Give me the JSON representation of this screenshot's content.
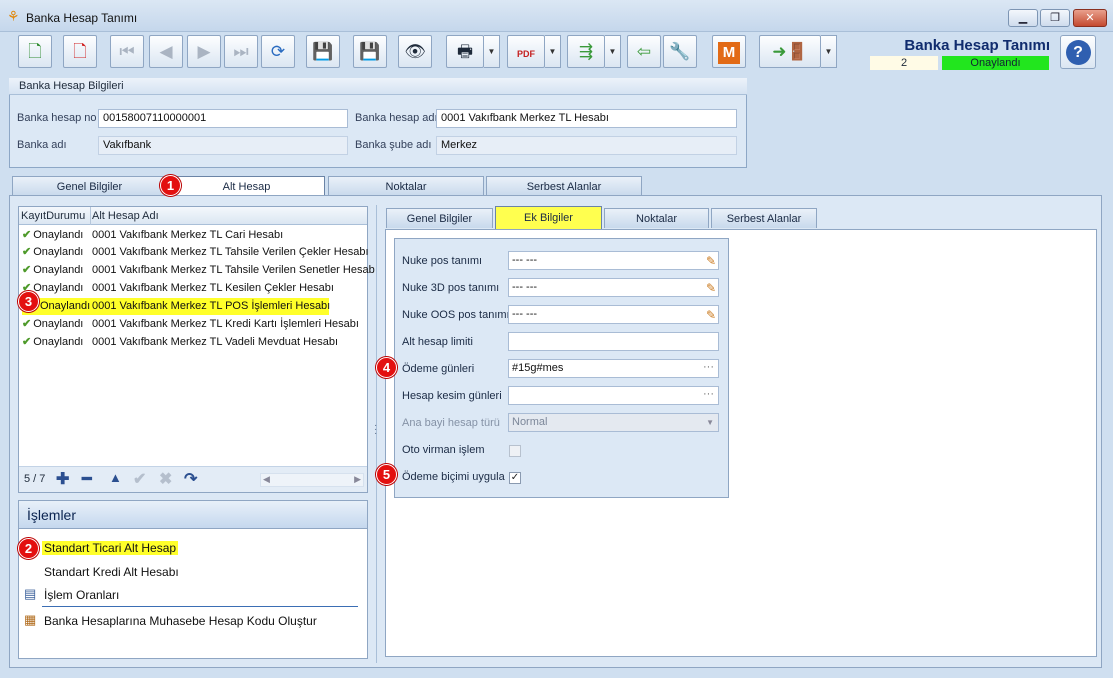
{
  "window": {
    "title": "Banka Hesap Tanımı",
    "minimize": "▁",
    "restore": "❐",
    "close": "✕"
  },
  "header": {
    "title": "Banka Hesap Tanımı",
    "record_no": "2",
    "status": "Onaylandı",
    "help": "?"
  },
  "toolbar": {
    "pdf": "PDF",
    "m_label": "M"
  },
  "group": {
    "title": "Banka Hesap Bilgileri",
    "fields": {
      "hesap_no_label": "Banka hesap no",
      "hesap_no": "00158007110000001",
      "hesap_adi_label": "Banka hesap adı",
      "hesap_adi": "0001 Vakıfbank Merkez TL Hesabı",
      "banka_adi_label": "Banka adı",
      "banka_adi": "Vakıfbank",
      "sube_adi_label": "Banka şube adı",
      "sube_adi": "Merkez"
    }
  },
  "tabs": [
    "Genel Bilgiler",
    "Alt Hesap",
    "Noktalar",
    "Serbest Alanlar"
  ],
  "grid": {
    "columns": [
      "KayıtDurumu",
      "Alt Hesap Adı"
    ],
    "rows": [
      {
        "status": "Onaylandı",
        "name": "0001 Vakıfbank Merkez TL Cari Hesabı"
      },
      {
        "status": "Onaylandı",
        "name": "0001 Vakıfbank Merkez TL Tahsile Verilen Çekler Hesabı"
      },
      {
        "status": "Onaylandı",
        "name": "0001 Vakıfbank Merkez TL Tahsile Verilen Senetler Hesab"
      },
      {
        "status": "Onaylandı",
        "name": "0001 Vakıfbank Merkez TL Kesilen Çekler Hesabı"
      },
      {
        "status": "Onaylandı",
        "name": "0001 Vakıfbank Merkez TL POS İşlemleri Hesabı"
      },
      {
        "status": "Onaylandı",
        "name": "0001 Vakıfbank Merkez TL Kredi Kartı İşlemleri Hesabı"
      },
      {
        "status": "Onaylandı",
        "name": "0001 Vakıfbank Merkez TL Vadeli Mevduat Hesabı"
      }
    ],
    "counter": "5 / 7"
  },
  "operations": {
    "title": "İşlemler",
    "items": [
      "Standart Ticari Alt Hesap",
      "Standart Kredi Alt Hesabı",
      "İşlem Oranları",
      "Banka Hesaplarına Muhasebe Hesap Kodu Oluştur"
    ]
  },
  "subtabs": [
    "Genel Bilgiler",
    "Ek Bilgiler",
    "Noktalar",
    "Serbest Alanlar"
  ],
  "form": {
    "nuke_pos_label": "Nuke pos tanımı",
    "nuke_pos": "--- ---",
    "nuke_3d_label": "Nuke 3D pos tanımı",
    "nuke_3d": "--- ---",
    "nuke_oos_label": "Nuke OOS pos tanımı",
    "nuke_oos": "--- ---",
    "alt_limit_label": "Alt hesap limiti",
    "alt_limit": "",
    "odeme_gunleri_label": "Ödeme günleri",
    "odeme_gunleri": "#15g#mes",
    "kesim_label": "Hesap kesim günleri",
    "kesim": "",
    "ana_bayi_label": "Ana bayi hesap türü",
    "ana_bayi": "Normal",
    "oto_virman_label": "Oto virman işlem",
    "oto_virman": false,
    "odeme_bicimi_label": "Ödeme biçimi uygula",
    "odeme_bicimi": true
  },
  "callouts": [
    "1",
    "2",
    "3",
    "4",
    "5"
  ],
  "colors": {
    "approved_green": "#22e61e",
    "highlight_yellow": "#ffff2a",
    "callout_red": "#e31010",
    "accent_navy": "#102c6e"
  }
}
